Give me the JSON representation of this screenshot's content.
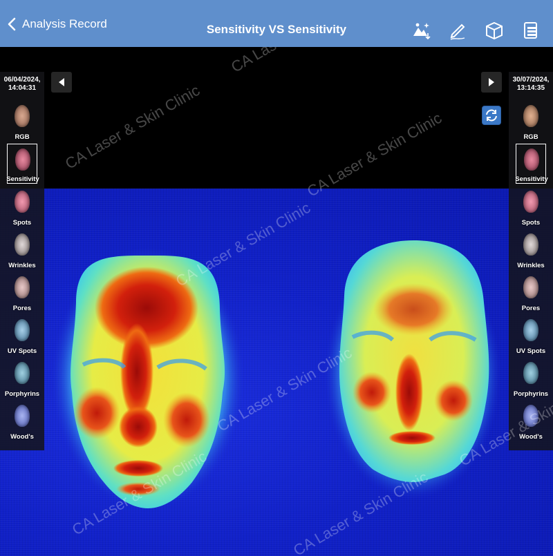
{
  "navbar": {
    "back_label": "Analysis Record",
    "title": "Sensitivity VS Sensitivity",
    "icons": [
      "image-adjust-icon",
      "pencil-icon",
      "cube-icon",
      "report-icon"
    ],
    "background": "#5f8fcc"
  },
  "left_panel": {
    "date": "06/04/2024,",
    "time": "14:04:31",
    "selected": "Sensitivity",
    "items": [
      {
        "label": "RGB"
      },
      {
        "label": "Sensitivity"
      },
      {
        "label": "Spots"
      },
      {
        "label": "Wrinkles"
      },
      {
        "label": "Pores"
      },
      {
        "label": "UV Spots"
      },
      {
        "label": "Porphyrins"
      },
      {
        "label": "Wood's"
      }
    ]
  },
  "right_panel": {
    "date": "30/07/2024,",
    "time": "13:14:35",
    "selected": "Sensitivity",
    "items": [
      {
        "label": "RGB"
      },
      {
        "label": "Sensitivity"
      },
      {
        "label": "Spots"
      },
      {
        "label": "Wrinkles"
      },
      {
        "label": "Pores"
      },
      {
        "label": "UV Spots"
      },
      {
        "label": "Porphyrins"
      },
      {
        "label": "Wood's"
      }
    ]
  },
  "watermark": "CA Laser & Skin Clinic"
}
